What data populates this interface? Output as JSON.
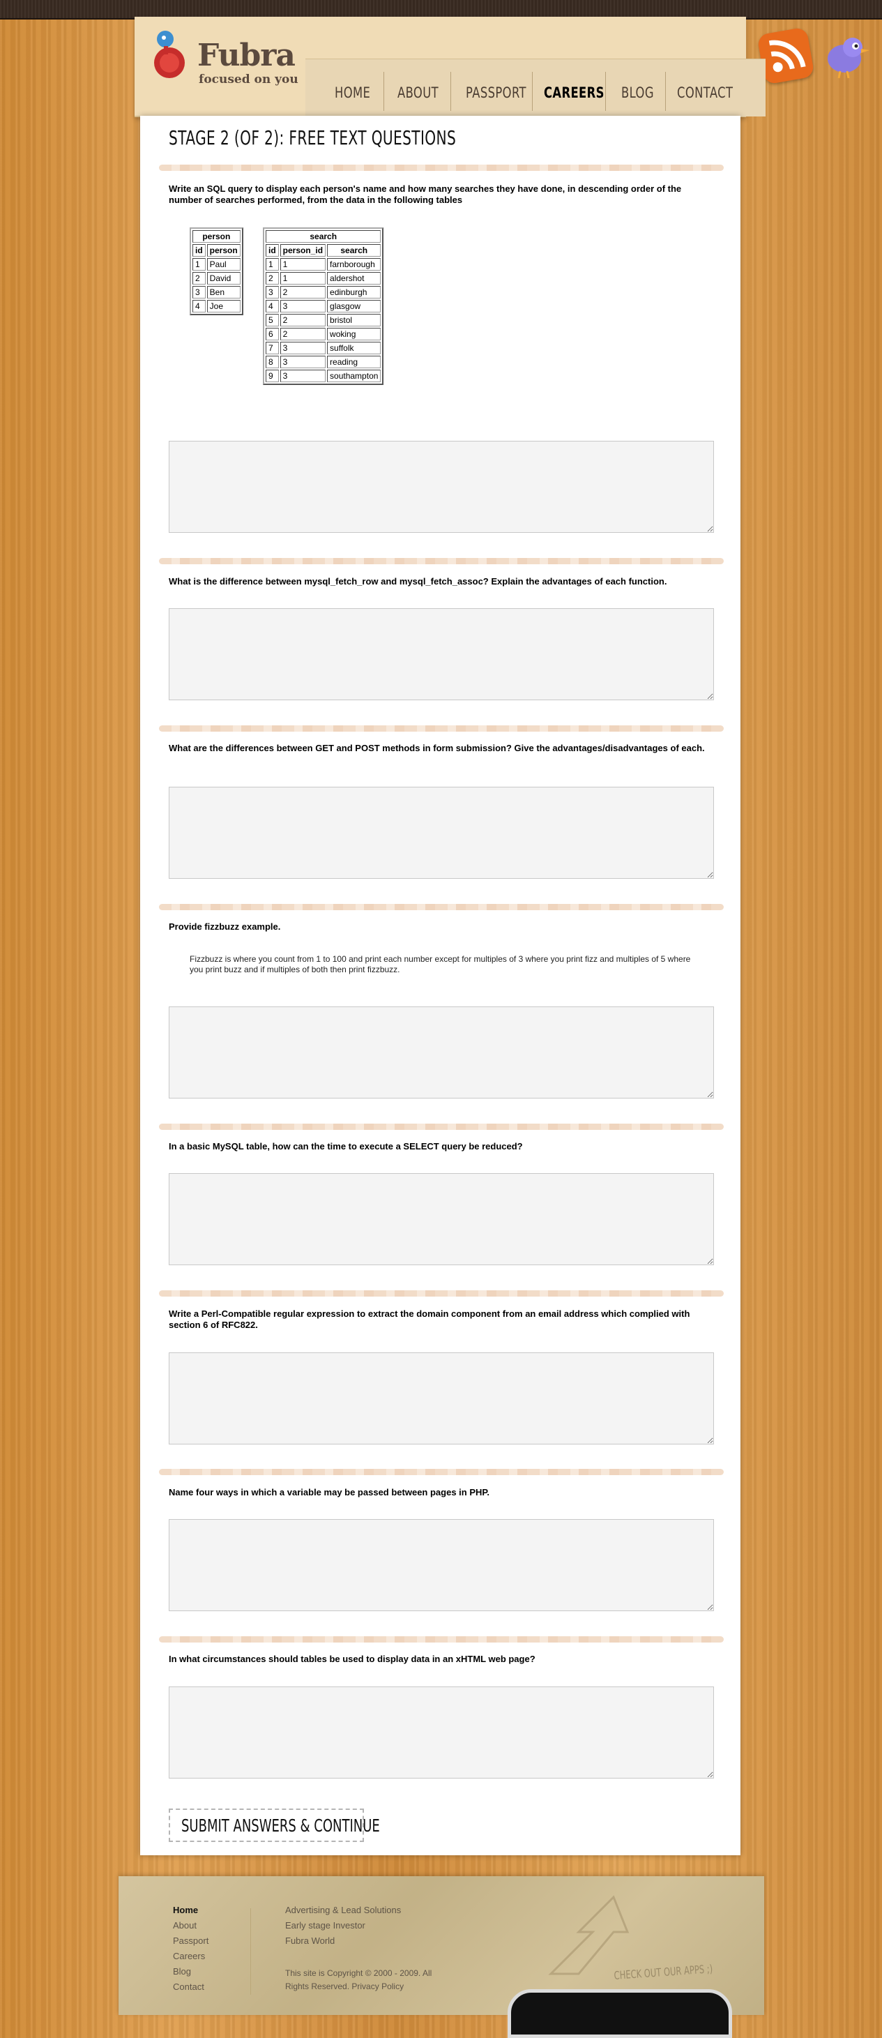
{
  "header": {
    "brand": "Fubra",
    "tagline": "focused on you",
    "nav": [
      {
        "label": "Home",
        "active": false
      },
      {
        "label": "About",
        "active": false
      },
      {
        "label": "Passport",
        "active": false
      },
      {
        "label": "Careers",
        "active": true
      },
      {
        "label": "Blog",
        "active": false
      },
      {
        "label": "Contact",
        "active": false
      }
    ]
  },
  "page": {
    "title": "Stage 2 (of 2): Free Text Questions"
  },
  "questions": [
    {
      "text": "Write an SQL query to display each person's name and how many searches they have done, in descending order of the number of searches performed, from the data in the following tables"
    },
    {
      "text": "What is the difference between mysql_fetch_row and mysql_fetch_assoc? Explain the advantages of each function."
    },
    {
      "text": "What are the differences between GET and POST methods in form submission? Give the advantages/disadvantages of each."
    },
    {
      "text": "Provide fizzbuzz example.",
      "note": "Fizzbuzz is where you count from 1 to 100 and print each number except for multiples of 3 where you print fizz and multiples of 5 where you print buzz and if multiples of both then print fizzbuzz."
    },
    {
      "text": "In a basic MySQL table, how can the time to execute a SELECT query be reduced?"
    },
    {
      "text": "Write a Perl-Compatible regular expression to extract the domain component from an email address which complied with section 6 of RFC822."
    },
    {
      "text": "Name four ways in which a variable may be passed between pages in PHP."
    },
    {
      "text": "In what circumstances should tables be used to display data in an xHTML web page?"
    }
  ],
  "person_table": {
    "caption": "person",
    "columns": [
      "id",
      "person"
    ],
    "rows": [
      [
        "1",
        "Paul"
      ],
      [
        "2",
        "David"
      ],
      [
        "3",
        "Ben"
      ],
      [
        "4",
        "Joe"
      ]
    ]
  },
  "search_table": {
    "caption": "search",
    "columns": [
      "id",
      "person_id",
      "search"
    ],
    "rows": [
      [
        "1",
        "1",
        "farnborough"
      ],
      [
        "2",
        "1",
        "aldershot"
      ],
      [
        "3",
        "2",
        "edinburgh"
      ],
      [
        "4",
        "3",
        "glasgow"
      ],
      [
        "5",
        "2",
        "bristol"
      ],
      [
        "6",
        "2",
        "woking"
      ],
      [
        "7",
        "3",
        "suffolk"
      ],
      [
        "8",
        "3",
        "reading"
      ],
      [
        "9",
        "3",
        "southampton"
      ]
    ]
  },
  "submit_label": "Submit Answers & Continue",
  "footer": {
    "links_left": [
      {
        "label": "Home",
        "active": true
      },
      {
        "label": "About",
        "active": false
      },
      {
        "label": "Passport",
        "active": false
      },
      {
        "label": "Careers",
        "active": false
      },
      {
        "label": "Blog",
        "active": false
      },
      {
        "label": "Contact",
        "active": false
      }
    ],
    "links_right": [
      "Advertising & Lead Solutions",
      "Early stage Investor",
      "Fubra World"
    ],
    "copyright_line1": "This site is Copyright © 2000 - 2009. All",
    "copyright_line2": "Rights Reserved.",
    "privacy_link": "Privacy Policy",
    "apps_label": "Check out our apps ;)"
  },
  "colors": {
    "wood": "#d48f3d",
    "paper": "#ffffff",
    "answer_bg": "#f4f4f4",
    "divider": "#f2dcc8"
  }
}
